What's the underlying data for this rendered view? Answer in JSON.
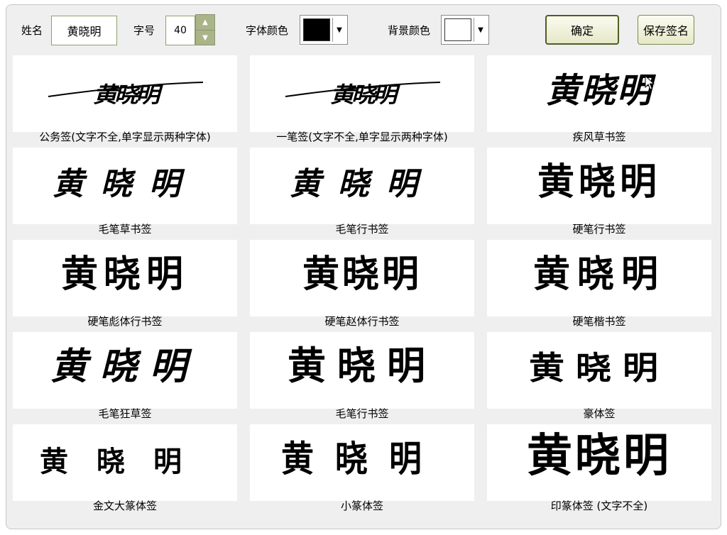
{
  "toolbar": {
    "name_label": "姓名",
    "name_value": "黄晓明",
    "size_label": "字号",
    "size_value": "40",
    "font_color_label": "字体颜色",
    "font_color": "#000000",
    "bg_color_label": "背景颜色",
    "bg_color": "#ffffff",
    "confirm_label": "确定",
    "save_label": "保存签名"
  },
  "signature_text": "黄晓明",
  "signatures": [
    {
      "caption": "公务签(文字不全,单字显示两种字体)"
    },
    {
      "caption": "一笔签(文字不全,单字显示两种字体)"
    },
    {
      "caption": "疾风草书签"
    },
    {
      "caption": "毛笔草书签"
    },
    {
      "caption": "毛笔行书签"
    },
    {
      "caption": "硬笔行书签"
    },
    {
      "caption": "硬笔彪体行书签"
    },
    {
      "caption": "硬笔赵体行书签"
    },
    {
      "caption": "硬笔楷书签"
    },
    {
      "caption": "毛笔狂草签"
    },
    {
      "caption": "毛笔行书签"
    },
    {
      "caption": "豪体签"
    },
    {
      "caption": "金文大篆体签"
    },
    {
      "caption": "小篆体签"
    },
    {
      "caption": "印篆体签 (文字不全)"
    }
  ]
}
